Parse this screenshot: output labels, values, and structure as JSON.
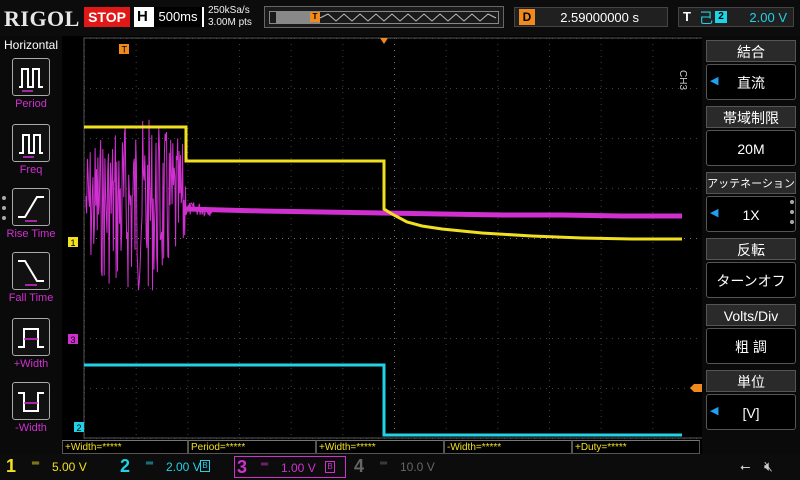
{
  "header": {
    "brand": "RIGOL",
    "run_state": "STOP",
    "timebase_label": "H",
    "timebase_value": "500ms",
    "sample_rate": "250kSa/s",
    "memory_points": "3.00M pts",
    "trigger_marker": "T",
    "delay_label": "D",
    "delay_value": "2.59000000 s",
    "trigger_label": "T",
    "trigger_channel": "2",
    "trigger_level": "2.00 V"
  },
  "sidebar": {
    "title": "Horizontal",
    "items": [
      {
        "label": "Period",
        "icon": "period-icon"
      },
      {
        "label": "Freq",
        "icon": "freq-icon"
      },
      {
        "label": "Rise Time",
        "icon": "rise-time-icon"
      },
      {
        "label": "Fall Time",
        "icon": "fall-time-icon"
      },
      {
        "label": "+Width",
        "icon": "pos-width-icon"
      },
      {
        "label": "-Width",
        "icon": "neg-width-icon"
      }
    ]
  },
  "plot": {
    "ch1_marker": "1",
    "ch3_marker": "3",
    "ch2_marker": "2",
    "trigger_marker": "T"
  },
  "measurements": [
    "+Width=*****",
    "Period=*****",
    "+Width=*****",
    "-Width=*****",
    "+Duty=*****"
  ],
  "right_menu": {
    "channel_tag": "CH3",
    "items": [
      {
        "title": "結合",
        "value": "直流"
      },
      {
        "title": "帯域制限",
        "value": "20M"
      },
      {
        "title": "アッテネーション",
        "value": "1X"
      },
      {
        "title": "反転",
        "value": "ターンオフ"
      },
      {
        "title": "Volts/Div",
        "value": "粗 調"
      },
      {
        "title": "単位",
        "value": "[V]"
      }
    ]
  },
  "channels": [
    {
      "num": "1",
      "coupling": "═",
      "scale": "5.00 V",
      "color": "#f0e020"
    },
    {
      "num": "2",
      "coupling": "═",
      "scale": "2.00 V",
      "color": "#20d2e6"
    },
    {
      "num": "3",
      "coupling": "═",
      "scale": "1.00 V",
      "color": "#d030d0"
    },
    {
      "num": "4",
      "coupling": "═",
      "scale": "10.0 V",
      "color": "#666666"
    }
  ],
  "colors": {
    "ch1": "#f0e020",
    "ch2": "#20d2e6",
    "ch3": "#d030d0",
    "trigger": "#f08a1c"
  }
}
